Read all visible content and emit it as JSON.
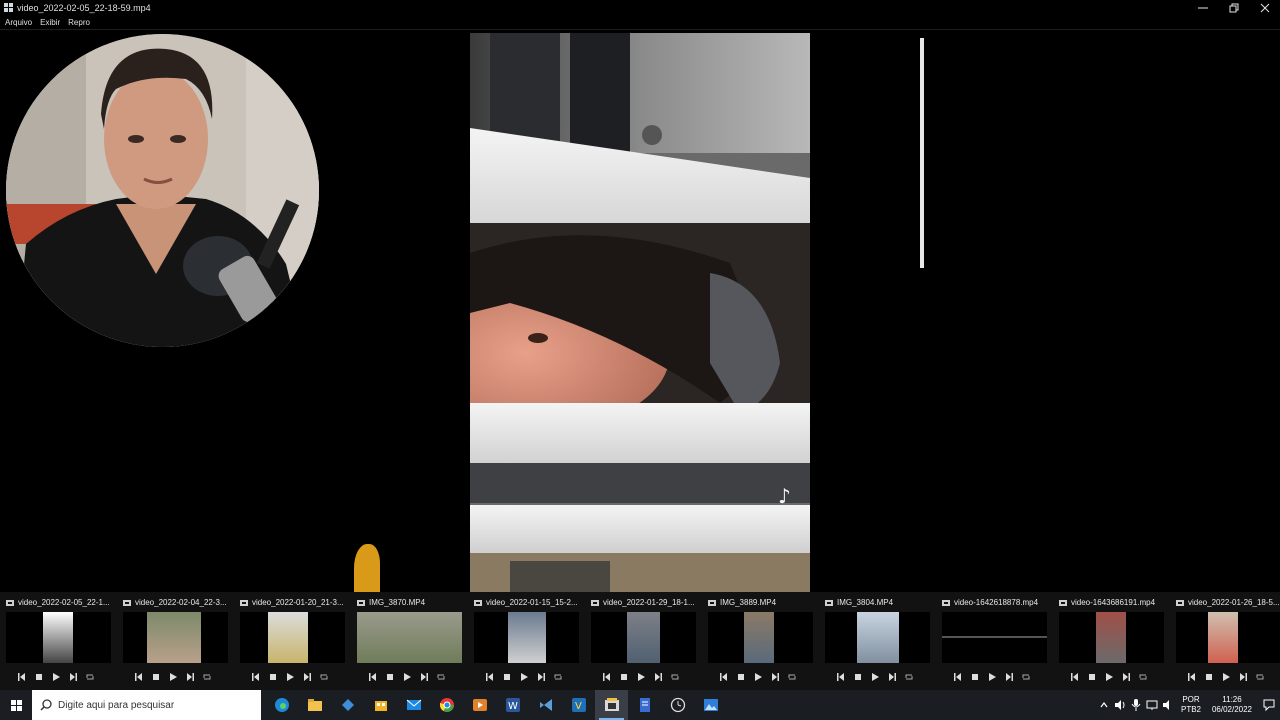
{
  "window": {
    "title": "video_2022-02-05_22-18-59.mp4",
    "minimize": "—",
    "restore": "❐",
    "close": "✕"
  },
  "menu": [
    "Arquivo",
    "Exibir",
    "Repro"
  ],
  "thumbnails": [
    {
      "title": "video_2022-02-05_22-1...",
      "icon": "film-icon"
    },
    {
      "title": "video_2022-02-04_22-3...",
      "icon": "film-icon"
    },
    {
      "title": "video_2022-01-20_21-3...",
      "icon": "film-icon"
    },
    {
      "title": "IMG_3870.MP4",
      "icon": "film-icon"
    },
    {
      "title": "video_2022-01-15_15-2...",
      "icon": "film-icon"
    },
    {
      "title": "video_2022-01-29_18-1...",
      "icon": "film-icon"
    },
    {
      "title": "IMG_3889.MP4",
      "icon": "film-icon"
    },
    {
      "title": "IMG_3804.MP4",
      "icon": "film-icon"
    },
    {
      "title": "video-1642618878.mp4",
      "icon": "film-icon"
    },
    {
      "title": "video-1643686191.mp4",
      "icon": "film-icon"
    },
    {
      "title": "video_2022-01-26_18-5...",
      "icon": "film-icon"
    }
  ],
  "taskbar": {
    "search_placeholder": "Digite aqui para pesquisar",
    "lang_line1": "POR",
    "lang_line2": "PTB2",
    "time": "11:26",
    "date": "06/02/2022"
  },
  "colors": {
    "taskbar": "#1a1d22",
    "strip": "#121212",
    "accent": "#7cb7f0"
  }
}
